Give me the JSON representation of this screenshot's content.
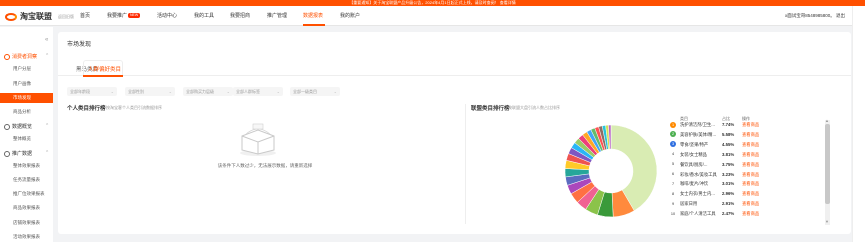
{
  "banner": {
    "text": "【重要通知】关于淘宝联盟产品升级公告，2024年4月1日起正式上线，请及时查阅！ 查看详情"
  },
  "brand": {
    "name": "淘宝联盟",
    "sub": "返回旧版"
  },
  "nav": {
    "items": [
      "首页",
      "我要推广",
      "活动中心",
      "我的工具",
      "我要招商",
      "推广管理",
      "数据报表",
      "我的账户"
    ],
    "new_badge": "NEW",
    "active_index": 6
  },
  "user": {
    "text": "x面试宝哥8548985800。 退出"
  },
  "sidebar": {
    "groups": [
      {
        "label": "消费者洞察",
        "items": [
          "用户分层",
          "用户画像",
          "市场发现",
          "商品分析"
        ]
      },
      {
        "label": "数据概览",
        "items": [
          "整体概览"
        ]
      },
      {
        "label": "推广数据",
        "items": [
          "整体效果报表",
          "任务流量报表",
          "推广位效果报表",
          "商品效果报表",
          "店铺效果报表",
          "活动效果报表"
        ]
      }
    ],
    "active_item": "市场发现"
  },
  "page": {
    "title": "市场发现",
    "tabs": [
      "黑马类目",
      "人群偏好类目"
    ],
    "active_tab": 1,
    "filters": [
      "全部年龄段",
      "全部性别",
      "全部购买力层级",
      "全部人群标签",
      "全部一级类目"
    ]
  },
  "left_card": {
    "title": "个人类目排行榜",
    "subtitle": "按淘宝客个人类目引流数据排序",
    "empty_text": "该条件下人数过少，无法展示数据，请重新选择"
  },
  "right_card": {
    "title": "联盟类目排行榜",
    "subtitle": "按联盟大盘引流人数占比排序",
    "col_category": "类目",
    "col_share": "占比",
    "col_action": "操作",
    "link_label": "查看商品",
    "rows": [
      {
        "rank": "1",
        "category": "洗护清洁剂/卫生...",
        "share": "7.74%",
        "color": "#ff8a00"
      },
      {
        "rank": "2",
        "category": "美容护肤/美体/精...",
        "share": "5.58%",
        "color": "#4caf50"
      },
      {
        "rank": "3",
        "category": "零食/坚果/特产",
        "share": "4.55%",
        "color": "#2f6fe0"
      },
      {
        "rank": "4",
        "category": "女装/女士精品",
        "share": "3.81%",
        "color": ""
      },
      {
        "rank": "5",
        "category": "餐饮具/厨房/...",
        "share": "3.75%",
        "color": ""
      },
      {
        "rank": "6",
        "category": "彩妆/香水/美妆工具",
        "share": "3.23%",
        "color": ""
      },
      {
        "rank": "7",
        "category": "咖啡/麦片/冲饮",
        "share": "3.01%",
        "color": ""
      },
      {
        "rank": "8",
        "category": "女士内衣/男士内...",
        "share": "2.96%",
        "color": ""
      },
      {
        "rank": "9",
        "category": "居家日用",
        "share": "2.91%",
        "color": ""
      },
      {
        "rank": "10",
        "category": "家庭/个人清洁工具",
        "share": "2.47%",
        "color": ""
      }
    ]
  },
  "chart_data": {
    "type": "pie",
    "donut": true,
    "slices": [
      {
        "value": 42.0,
        "color": "#d9ecb3"
      },
      {
        "value": 7.74,
        "color": "#ff8a3d"
      },
      {
        "value": 5.58,
        "color": "#3a9a3a"
      },
      {
        "value": 4.55,
        "color": "#8bc34a"
      },
      {
        "value": 3.81,
        "color": "#f06292"
      },
      {
        "value": 3.75,
        "color": "#ff7043"
      },
      {
        "value": 3.23,
        "color": "#ab47bc"
      },
      {
        "value": 3.01,
        "color": "#5c6bc0"
      },
      {
        "value": 2.96,
        "color": "#26a69a"
      },
      {
        "value": 2.91,
        "color": "#ffca28"
      },
      {
        "value": 2.47,
        "color": "#ef5350"
      },
      {
        "value": 2.3,
        "color": "#7e57c2"
      },
      {
        "value": 2.1,
        "color": "#29b6f6"
      },
      {
        "value": 2.0,
        "color": "#9ccc65"
      },
      {
        "value": 1.9,
        "color": "#ec407a"
      },
      {
        "value": 1.8,
        "color": "#ffa726"
      },
      {
        "value": 1.6,
        "color": "#42a5f5"
      },
      {
        "value": 1.5,
        "color": "#66bb6a"
      },
      {
        "value": 1.4,
        "color": "#ff5252"
      },
      {
        "value": 1.3,
        "color": "#8d6e63"
      },
      {
        "value": 1.2,
        "color": "#26c6da"
      },
      {
        "value": 1.0,
        "color": "#d4e157"
      },
      {
        "value": 0.9,
        "color": "#ba68c8"
      }
    ]
  }
}
